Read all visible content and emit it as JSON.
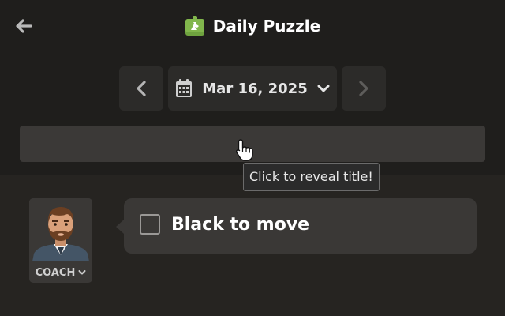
{
  "header": {
    "title": "Daily Puzzle",
    "back_icon": "arrow-left-icon",
    "title_icon": "puzzle-piece-icon"
  },
  "date_nav": {
    "date": "Mar 16, 2025",
    "prev_icon": "chevron-left-icon",
    "next_icon": "chevron-right-icon",
    "calendar_icon": "calendar-icon",
    "dropdown_icon": "chevron-down-icon"
  },
  "reveal": {
    "tooltip": "Click to reveal title!"
  },
  "coach": {
    "label": "COACH"
  },
  "message": {
    "text": "Black to move"
  },
  "colors": {
    "background": "#262421",
    "panel": "#1f1e1c",
    "button": "#2c2b29",
    "accent_green": "#81b64c"
  }
}
